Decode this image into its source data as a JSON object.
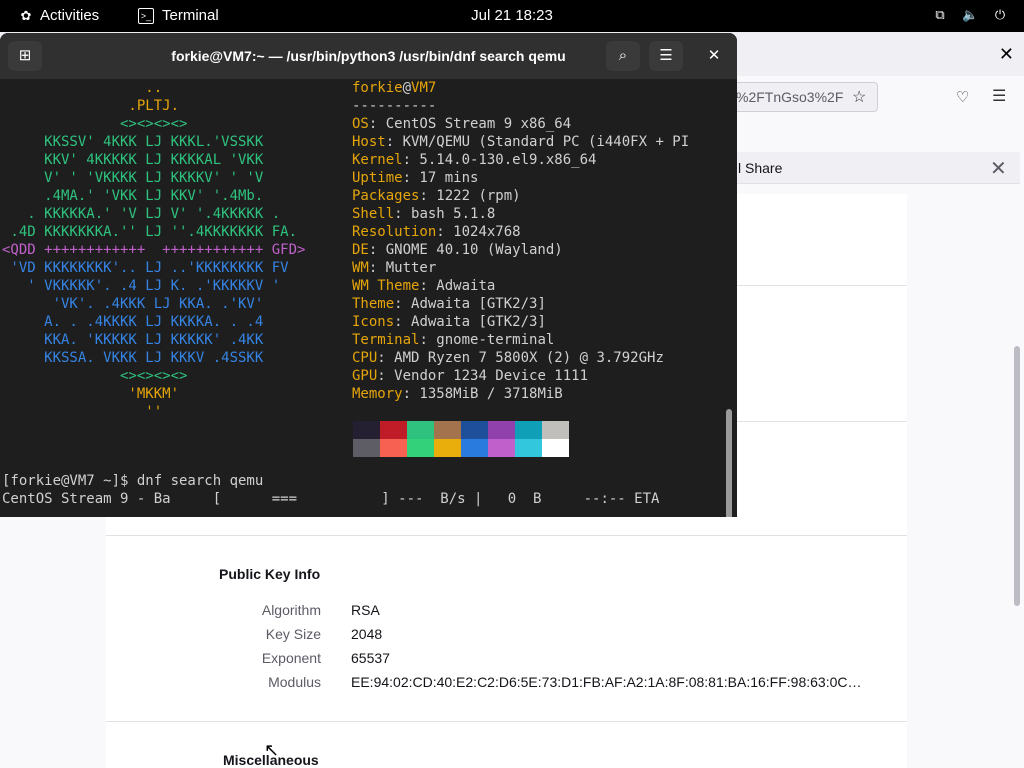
{
  "topbar": {
    "activities": "Activities",
    "app": "Terminal",
    "clock": "Jul 21  18:23"
  },
  "firefox": {
    "url_fragment": "%2FTnGso3%2F",
    "share_button": "l Share",
    "sections": {
      "public_key_title": "Public Key Info",
      "rows": [
        {
          "key": "Algorithm",
          "value": "RSA"
        },
        {
          "key": "Key Size",
          "value": "2048"
        },
        {
          "key": "Exponent",
          "value": "65537"
        },
        {
          "key": "Modulus",
          "value": "EE:94:02:CD:40:E2:C2:D6:5E:73:D1:FB:AF:A2:1A:8F:08:81:BA:16:FF:98:63:0C…"
        }
      ],
      "misc_title": "Miscellaneous"
    }
  },
  "terminal": {
    "title": "forkie@VM7:~ — /usr/bin/python3 /usr/bin/dnf search qemu",
    "user": "forkie",
    "at": "@",
    "host": "VM7",
    "sep": "----------",
    "info": [
      {
        "label": "OS",
        "value": ": CentOS Stream 9 x86_64"
      },
      {
        "label": "Host",
        "value": ": KVM/QEMU (Standard PC (i440FX + PI"
      },
      {
        "label": "Kernel",
        "value": ": 5.14.0-130.el9.x86_64"
      },
      {
        "label": "Uptime",
        "value": ": 17 mins"
      },
      {
        "label": "Packages",
        "value": ": 1222 (rpm)"
      },
      {
        "label": "Shell",
        "value": ": bash 5.1.8"
      },
      {
        "label": "Resolution",
        "value": ": 1024x768"
      },
      {
        "label": "DE",
        "value": ": GNOME 40.10 (Wayland)"
      },
      {
        "label": "WM",
        "value": ": Mutter"
      },
      {
        "label": "WM Theme",
        "value": ": Adwaita"
      },
      {
        "label": "Theme",
        "value": ": Adwaita [GTK2/3]"
      },
      {
        "label": "Icons",
        "value": ": Adwaita [GTK2/3]"
      },
      {
        "label": "Terminal",
        "value": ": gnome-terminal"
      },
      {
        "label": "CPU",
        "value": ": AMD Ryzen 7 5800X (2) @ 3.792GHz"
      },
      {
        "label": "GPU",
        "value": ": Vendor 1234 Device 1111"
      },
      {
        "label": "Memory",
        "value": ": 1358MiB / 3718MiB"
      }
    ],
    "prompt": "[forkie@VM7 ~]$ dnf search qemu",
    "progress": "CentOS Stream 9 - Ba     [      ===          ] ---  B/s |   0  B     --:-- ETA",
    "colors_top": [
      "#241f31",
      "#c01c28",
      "#2ec27e",
      "#a2734c",
      "#1e4f9a",
      "#9141ac",
      "#0fa0b8",
      "#c0bfbc"
    ],
    "colors_bottom": [
      "#5e5c64",
      "#f66151",
      "#33d17a",
      "#e9ad0c",
      "#2a7bde",
      "#c061cb",
      "#33c7de",
      "#ffffff"
    ]
  },
  "logo_lines": [
    "                 ..",
    "               .PLTJ.",
    "              <><><><>",
    "     KKSSV' 4KKK LJ KKKL.'VSSKK",
    "     KKV' 4KKKKK LJ KKKKAL 'VKK",
    "     V' ' 'VKKKK LJ KKKKV' ' 'V",
    "     .4MA.' 'VKK LJ KKV' '.4Mb.",
    "   . KKKKKA.' 'V LJ V' '.4KKKKK .",
    " .4D KKKKKKKA.'' LJ ''.4KKKKKKK FA.",
    "<QDD ++++++++++++  ++++++++++++ GFD>",
    " 'VD KKKKKKKK'.. LJ ..'KKKKKKKK FV",
    "   ' VKKKKK'. .4 LJ K. .'KKKKKV '",
    "      'VK'. .4KKK LJ KKA. .'KV'",
    "     A. . .4KKKK LJ KKKKA. . .4",
    "     KKA. 'KKKKK LJ KKKKK' .4KK",
    "     KKSSA. VKKK LJ KKKV .4SSKK",
    "              <><><><>",
    "               'MKKM'",
    "                 ''"
  ]
}
